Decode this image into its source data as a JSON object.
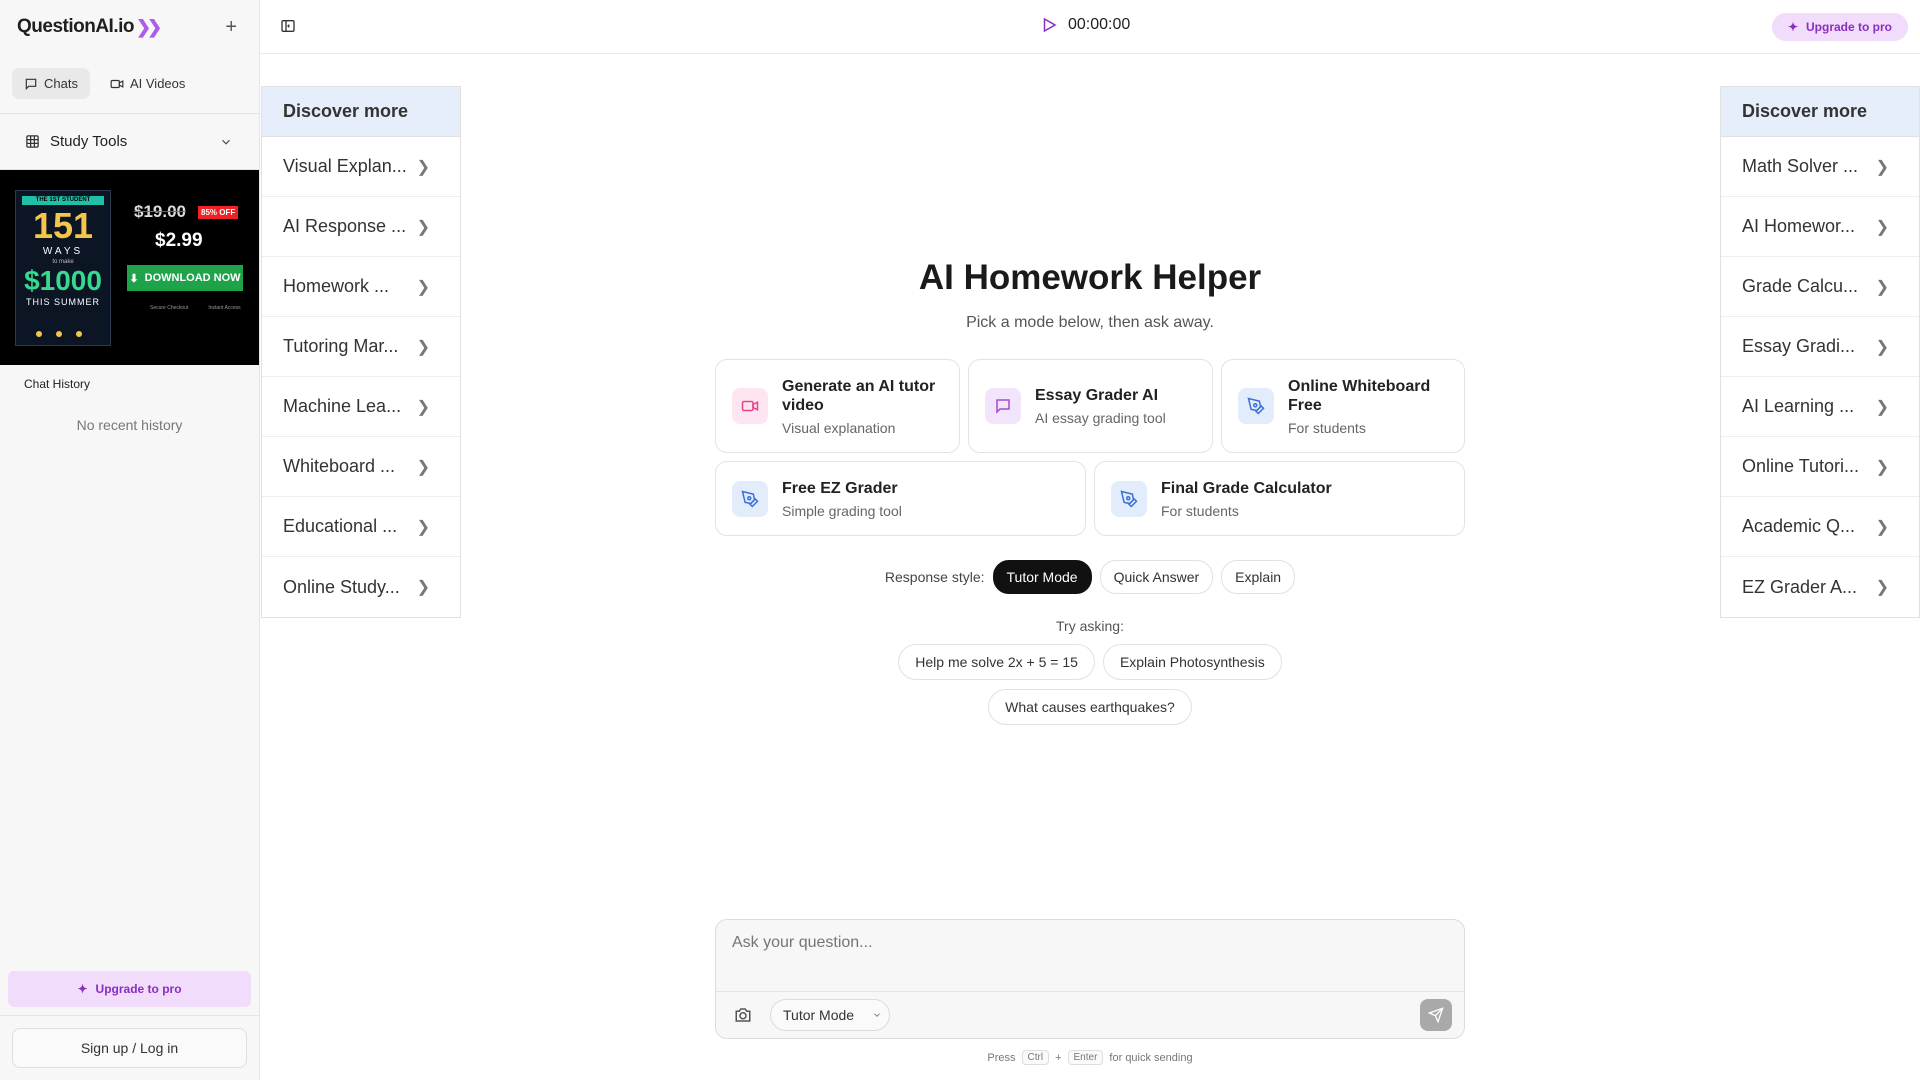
{
  "sidebar": {
    "logo": "QuestionAI.io",
    "tabs": [
      {
        "label": "Chats",
        "active": true,
        "icon": "chat-bubble-icon"
      },
      {
        "label": "AI Videos",
        "active": false,
        "icon": "video-camera-icon"
      }
    ],
    "study_tools_label": "Study Tools",
    "ad": {
      "book_tag": "THE 1ST STUDENT",
      "book_number": "151",
      "book_ways": "WAYS",
      "book_to_make": "to make",
      "book_amount": "$1000",
      "book_summer": "THIS SUMMER",
      "old_price": "$19.00",
      "discount": "85% OFF",
      "new_price": "$2.99",
      "download_label": "DOWNLOAD NOW",
      "secure_label": "Secure Checkout",
      "instant_label": "Instant Access"
    },
    "chat_history_label": "Chat History",
    "no_history": "No recent history",
    "upgrade_label": "Upgrade to pro",
    "signup_label": "Sign up / Log in"
  },
  "header": {
    "timer": "00:00:00",
    "upgrade_label": "Upgrade to pro"
  },
  "discover_left": {
    "title": "Discover more",
    "items": [
      "Visual Explan...",
      "AI Response ...",
      "Homework ...",
      "Tutoring Mar...",
      "Machine Lea...",
      "Whiteboard ...",
      "Educational ...",
      "Online Study..."
    ]
  },
  "discover_right": {
    "title": "Discover more",
    "items": [
      "Math Solver ...",
      "AI Homewor...",
      "Grade Calcu...",
      "Essay Gradi...",
      "AI Learning ...",
      "Online Tutori...",
      "Academic Q...",
      "EZ Grader A..."
    ]
  },
  "main": {
    "title": "AI Homework Helper",
    "subtitle": "Pick a mode below, then ask away.",
    "cards": [
      {
        "title": "Generate an AI tutor video",
        "subtitle": "Visual explanation",
        "icon": "video-camera-icon",
        "color": "#e8428c"
      },
      {
        "title": "Essay Grader AI",
        "subtitle": "AI essay grading tool",
        "icon": "message-square-icon",
        "color": "#a24bd8"
      },
      {
        "title": "Online Whiteboard Free",
        "subtitle": "For students",
        "icon": "pen-tool-icon",
        "color": "#3b6fd6"
      },
      {
        "title": "Free EZ Grader",
        "subtitle": "Simple grading tool",
        "icon": "pen-tool-icon",
        "color": "#3b6fd6"
      },
      {
        "title": "Final Grade Calculator",
        "subtitle": "For students",
        "icon": "pen-tool-icon",
        "color": "#3b6fd6"
      }
    ],
    "response_style_label": "Response style:",
    "response_styles": [
      {
        "label": "Tutor Mode",
        "active": true
      },
      {
        "label": "Quick Answer",
        "active": false
      },
      {
        "label": "Explain",
        "active": false
      }
    ],
    "try_asking_label": "Try asking:",
    "suggestions_row1": [
      "Help me solve 2x + 5 = 15",
      "Explain Photosynthesis"
    ],
    "suggestions_row2": [
      "What causes earthquakes?"
    ]
  },
  "input": {
    "placeholder": "Ask your question...",
    "mode_label": "Tutor Mode"
  },
  "hint": {
    "press": "Press",
    "key1": "Ctrl",
    "plus": "+",
    "key2": "Enter",
    "suffix": "for quick sending"
  }
}
